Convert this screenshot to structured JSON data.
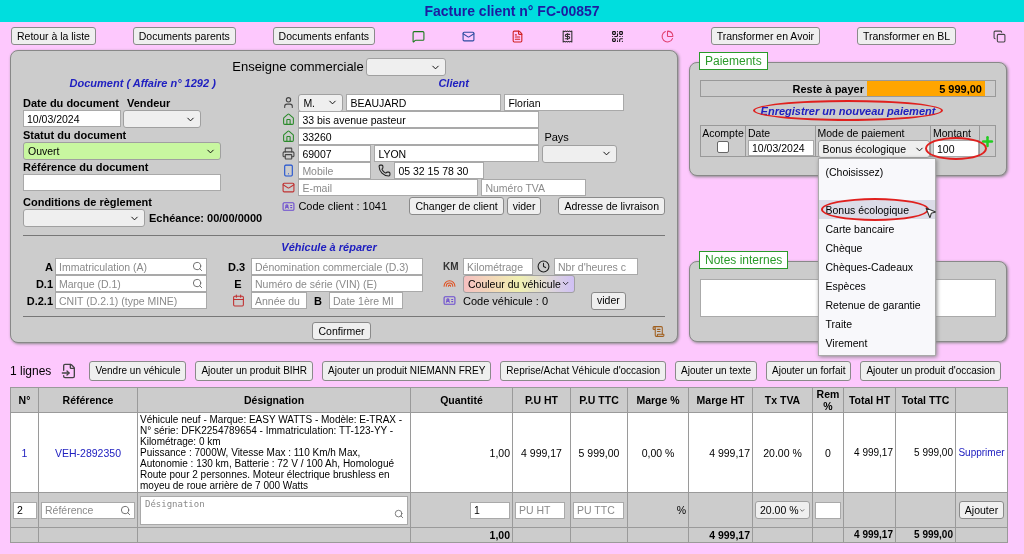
{
  "title": "Facture client n° FC-00857",
  "toolbar": {
    "left_buttons": [
      "Retour à la liste",
      "Documents parents",
      "Documents enfants"
    ],
    "right_buttons": [
      "Transformer en Avoir",
      "Transformer en BL"
    ]
  },
  "document": {
    "enseigne_label": "Enseigne commerciale",
    "heading": "Document ( Affaire n° 1292 )",
    "date_label": "Date du document",
    "date_value": "10/03/2024",
    "vendeur_label": "Vendeur",
    "statut_label": "Statut du document",
    "statut_value": "Ouvert",
    "reference_label": "Référence du document",
    "conditions_label": "Conditions de règlement",
    "echeance": "Echéance: 00/00/0000"
  },
  "client": {
    "heading": "Client",
    "civilite": "M.",
    "nom": "BEAUJARD",
    "prenom": "Florian",
    "adresse": "33 bis avenue pasteur",
    "adresse2": "33260",
    "pays_label": "Pays",
    "code_postal": "69007",
    "ville": "LYON",
    "mobile_placeholder": "Mobile",
    "telephone": "05 32 15 78 30",
    "email_placeholder": "E-mail",
    "tva_placeholder": "Numéro TVA",
    "code_client": "Code client : 1041",
    "buttons": [
      "Changer de client",
      "vider",
      "Adresse de livraison"
    ]
  },
  "vehicle": {
    "heading": "Véhicule à réparer",
    "column_1": [
      {
        "code": "A",
        "placeholder": "Immatriculation (A)",
        "kind": "search"
      },
      {
        "code": "D.1",
        "placeholder": "Marque (D.1)",
        "kind": "search"
      },
      {
        "code": "D.2.1",
        "placeholder": "CNIT (D.2.1) (type MINE)",
        "kind": "plain"
      }
    ],
    "denomination_code": "D.3",
    "denomination_placeholder": "Dénomination commerciale (D.3)",
    "serie_code": "E",
    "serie_placeholder": "Numéro de série (VIN) (E)",
    "annee_placeholder": "Année du",
    "b_code": "B",
    "mise_en_circulation_placeholder": "Date 1ère MI",
    "km_label": "KM",
    "km_placeholder": "Kilométrage",
    "heures_placeholder": "Nbr d'heures c",
    "couleur": "Couleur du véhicule",
    "code_vehicule": "Code véhicule : 0",
    "vider": "vider"
  },
  "confirm": "Confirmer",
  "payments": {
    "legend": "Paiements",
    "reste_label": "Reste à payer",
    "reste_value": "5 999,00",
    "new_link": "Enregistrer un nouveau paiement",
    "new_link_circled": true,
    "acompte_label": "Acompte",
    "acompte_checked": false,
    "date_label": "Date",
    "date_value": "10/03/2024",
    "mode_label": "Mode de paiement",
    "mode_value": "Bonus écologique",
    "montant_label": "Montant",
    "montant_value": "100",
    "montant_circled": true,
    "options": [
      {
        "kind": "option",
        "label": "(Choisissez)",
        "selected": false,
        "circled": false
      },
      {
        "kind": "blank",
        "selected": false,
        "circled": false
      },
      {
        "kind": "option",
        "label": "Bonus écologique",
        "selected": true,
        "circled": true
      },
      {
        "kind": "option",
        "label": "Carte bancaire",
        "selected": false,
        "circled": false
      },
      {
        "kind": "option",
        "label": "Chèque",
        "selected": false,
        "circled": false
      },
      {
        "kind": "option",
        "label": "Chèques-Cadeaux",
        "selected": false,
        "circled": false
      },
      {
        "kind": "option",
        "label": "Espèces",
        "selected": false,
        "circled": false
      },
      {
        "kind": "option",
        "label": "Retenue de garantie",
        "selected": false,
        "circled": false
      },
      {
        "kind": "option",
        "label": "Traite",
        "selected": false,
        "circled": false
      },
      {
        "kind": "option",
        "label": "Virement",
        "selected": false,
        "circled": false
      }
    ]
  },
  "notes": {
    "legend": "Notes internes"
  },
  "lines": {
    "count": "1 lignes",
    "buttons": [
      "Vendre un véhicule",
      "Ajouter un produit BIHR",
      "Ajouter un produit NIEMANN FREY",
      "Reprise/Achat Véhicule d'occasion",
      "Ajouter un texte",
      "Ajouter un forfait",
      "Ajouter un produit d'occasion"
    ]
  },
  "table": {
    "columns": [
      "N°",
      "Référence",
      "Désignation",
      "Quantité",
      "P.U HT",
      "P.U TTC",
      "Marge %",
      "Marge HT",
      "Tx TVA",
      "Rem %",
      "Total HT",
      "Total TTC"
    ],
    "rows": [
      {
        "n": "1",
        "reference": "VEH-2892350",
        "designation": "Véhicule neuf - Marque: EASY WATTS - Modèle: E-TRAX - N° série: DFK2254789654 - Immatriculation: TT-123-YY - Kilométrage: 0 km\nPuissance : 7000W, Vitesse Max : 110 Km/h Max, Autonomie : 130 km, Batterie : 72 V / 100 Ah, Homologué Route pour 2 personnes. Moteur électrique brushless en moyeu de roue arrière de 7 000 Watts",
        "quantite": "1,00",
        "pu_ht": "4 999,17",
        "pu_ttc": "5 999,00",
        "marge_pct": "0,00 %",
        "marge_ht": "4 999,17",
        "tva": "20.00 %",
        "rem": "0",
        "total_ht": "4 999,17",
        "total_ttc": "5 999,00",
        "action": "Supprimer"
      }
    ],
    "new_row": {
      "n": "2",
      "reference_placeholder": "Référence",
      "designation_placeholder": "Désignation",
      "quantite": "1",
      "pu_ht_placeholder": "PU HT",
      "pu_ttc_placeholder": "PU TTC",
      "pct": "%",
      "tva": "20.00 %",
      "button": "Ajouter"
    },
    "totals": {
      "quantite": "1,00",
      "marge_ht": "4 999,17",
      "total_ht": "4 999,17",
      "total_ttc": "5 999,00"
    }
  }
}
